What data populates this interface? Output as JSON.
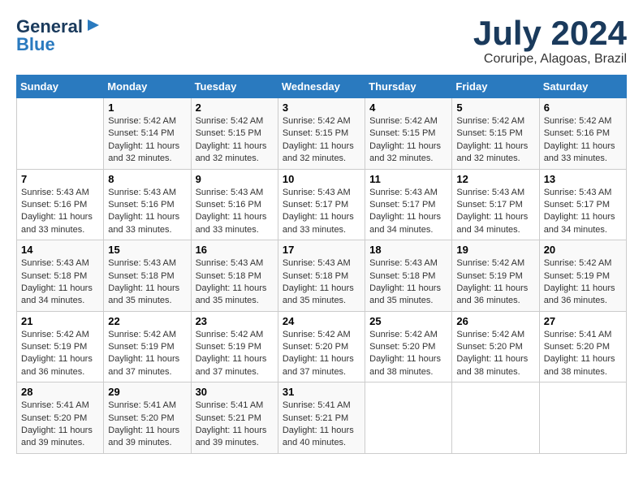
{
  "header": {
    "logo_line1": "General",
    "logo_line2": "Blue",
    "month_year": "July 2024",
    "location": "Coruripe, Alagoas, Brazil"
  },
  "weekdays": [
    "Sunday",
    "Monday",
    "Tuesday",
    "Wednesday",
    "Thursday",
    "Friday",
    "Saturday"
  ],
  "weeks": [
    [
      {
        "day": "",
        "info": ""
      },
      {
        "day": "1",
        "info": "Sunrise: 5:42 AM\nSunset: 5:14 PM\nDaylight: 11 hours\nand 32 minutes."
      },
      {
        "day": "2",
        "info": "Sunrise: 5:42 AM\nSunset: 5:15 PM\nDaylight: 11 hours\nand 32 minutes."
      },
      {
        "day": "3",
        "info": "Sunrise: 5:42 AM\nSunset: 5:15 PM\nDaylight: 11 hours\nand 32 minutes."
      },
      {
        "day": "4",
        "info": "Sunrise: 5:42 AM\nSunset: 5:15 PM\nDaylight: 11 hours\nand 32 minutes."
      },
      {
        "day": "5",
        "info": "Sunrise: 5:42 AM\nSunset: 5:15 PM\nDaylight: 11 hours\nand 32 minutes."
      },
      {
        "day": "6",
        "info": "Sunrise: 5:42 AM\nSunset: 5:16 PM\nDaylight: 11 hours\nand 33 minutes."
      }
    ],
    [
      {
        "day": "7",
        "info": "Sunrise: 5:43 AM\nSunset: 5:16 PM\nDaylight: 11 hours\nand 33 minutes."
      },
      {
        "day": "8",
        "info": "Sunrise: 5:43 AM\nSunset: 5:16 PM\nDaylight: 11 hours\nand 33 minutes."
      },
      {
        "day": "9",
        "info": "Sunrise: 5:43 AM\nSunset: 5:16 PM\nDaylight: 11 hours\nand 33 minutes."
      },
      {
        "day": "10",
        "info": "Sunrise: 5:43 AM\nSunset: 5:17 PM\nDaylight: 11 hours\nand 33 minutes."
      },
      {
        "day": "11",
        "info": "Sunrise: 5:43 AM\nSunset: 5:17 PM\nDaylight: 11 hours\nand 34 minutes."
      },
      {
        "day": "12",
        "info": "Sunrise: 5:43 AM\nSunset: 5:17 PM\nDaylight: 11 hours\nand 34 minutes."
      },
      {
        "day": "13",
        "info": "Sunrise: 5:43 AM\nSunset: 5:17 PM\nDaylight: 11 hours\nand 34 minutes."
      }
    ],
    [
      {
        "day": "14",
        "info": "Sunrise: 5:43 AM\nSunset: 5:18 PM\nDaylight: 11 hours\nand 34 minutes."
      },
      {
        "day": "15",
        "info": "Sunrise: 5:43 AM\nSunset: 5:18 PM\nDaylight: 11 hours\nand 35 minutes."
      },
      {
        "day": "16",
        "info": "Sunrise: 5:43 AM\nSunset: 5:18 PM\nDaylight: 11 hours\nand 35 minutes."
      },
      {
        "day": "17",
        "info": "Sunrise: 5:43 AM\nSunset: 5:18 PM\nDaylight: 11 hours\nand 35 minutes."
      },
      {
        "day": "18",
        "info": "Sunrise: 5:43 AM\nSunset: 5:18 PM\nDaylight: 11 hours\nand 35 minutes."
      },
      {
        "day": "19",
        "info": "Sunrise: 5:42 AM\nSunset: 5:19 PM\nDaylight: 11 hours\nand 36 minutes."
      },
      {
        "day": "20",
        "info": "Sunrise: 5:42 AM\nSunset: 5:19 PM\nDaylight: 11 hours\nand 36 minutes."
      }
    ],
    [
      {
        "day": "21",
        "info": "Sunrise: 5:42 AM\nSunset: 5:19 PM\nDaylight: 11 hours\nand 36 minutes."
      },
      {
        "day": "22",
        "info": "Sunrise: 5:42 AM\nSunset: 5:19 PM\nDaylight: 11 hours\nand 37 minutes."
      },
      {
        "day": "23",
        "info": "Sunrise: 5:42 AM\nSunset: 5:19 PM\nDaylight: 11 hours\nand 37 minutes."
      },
      {
        "day": "24",
        "info": "Sunrise: 5:42 AM\nSunset: 5:20 PM\nDaylight: 11 hours\nand 37 minutes."
      },
      {
        "day": "25",
        "info": "Sunrise: 5:42 AM\nSunset: 5:20 PM\nDaylight: 11 hours\nand 38 minutes."
      },
      {
        "day": "26",
        "info": "Sunrise: 5:42 AM\nSunset: 5:20 PM\nDaylight: 11 hours\nand 38 minutes."
      },
      {
        "day": "27",
        "info": "Sunrise: 5:41 AM\nSunset: 5:20 PM\nDaylight: 11 hours\nand 38 minutes."
      }
    ],
    [
      {
        "day": "28",
        "info": "Sunrise: 5:41 AM\nSunset: 5:20 PM\nDaylight: 11 hours\nand 39 minutes."
      },
      {
        "day": "29",
        "info": "Sunrise: 5:41 AM\nSunset: 5:20 PM\nDaylight: 11 hours\nand 39 minutes."
      },
      {
        "day": "30",
        "info": "Sunrise: 5:41 AM\nSunset: 5:21 PM\nDaylight: 11 hours\nand 39 minutes."
      },
      {
        "day": "31",
        "info": "Sunrise: 5:41 AM\nSunset: 5:21 PM\nDaylight: 11 hours\nand 40 minutes."
      },
      {
        "day": "",
        "info": ""
      },
      {
        "day": "",
        "info": ""
      },
      {
        "day": "",
        "info": ""
      }
    ]
  ]
}
